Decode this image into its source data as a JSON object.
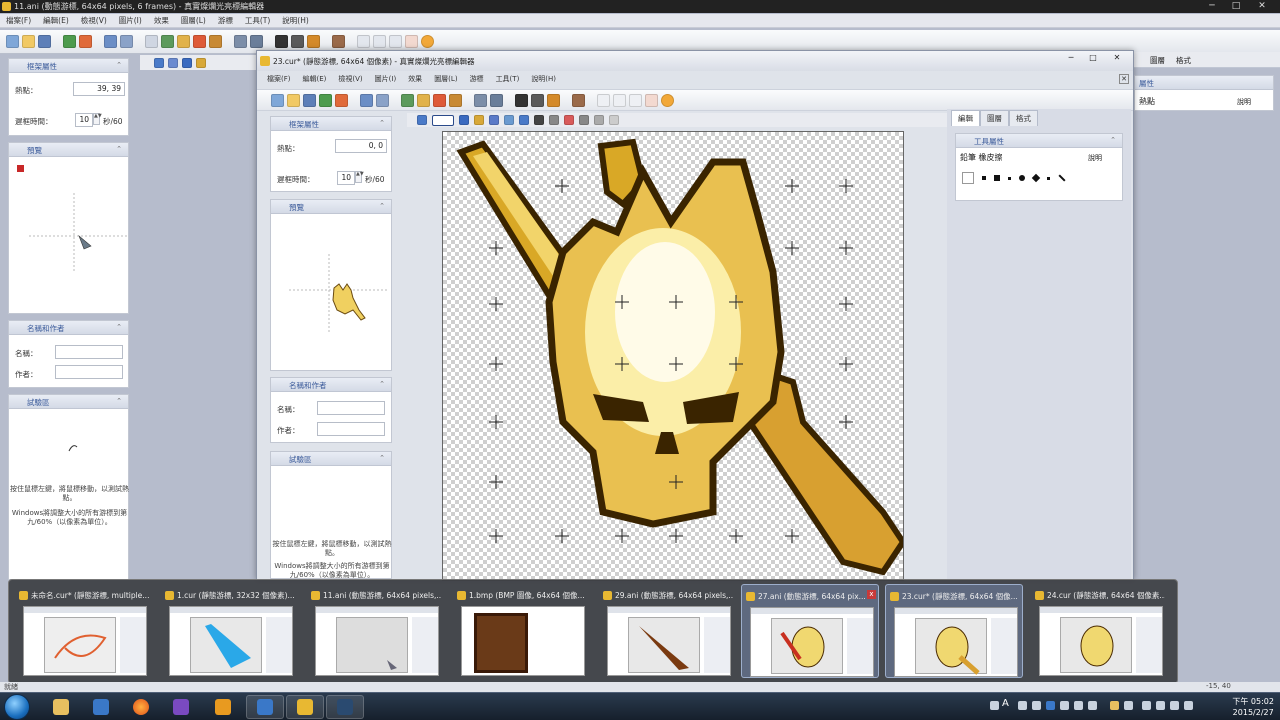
{
  "outer_window": {
    "title": "11.ani (動態游標, 64x64 pixels, 6 frames) - 真實燦爛光亮標編輯器",
    "menu": [
      "檔案(F)",
      "編輯(E)",
      "檢視(V)",
      "圖片(I)",
      "效果",
      "圖層(L)",
      "游標",
      "工具(T)",
      "說明(H)"
    ],
    "right_tabs": [
      "圖層",
      "格式"
    ],
    "right_panel_header": "屬性",
    "hotspot_panel_text": "熱點",
    "help_label": "說明",
    "frame_props": {
      "header": "框架屬性",
      "hotspot_label": "熱點：",
      "hotspot_value": "39, 39",
      "delay_label": "遲框時間：",
      "delay_value": "10",
      "delay_unit": "秒/60"
    },
    "preview": {
      "header": "預覽"
    },
    "name_author": {
      "header": "名稱和作者",
      "name_label": "名稱：",
      "author_label": "作者："
    },
    "test_area": {
      "header": "試驗區",
      "text1": "按住鼠標左鍵，將鼠標移動，以測試熱點。",
      "text2": "Windows將調整大小的所有游標到第九/60%（以像素為單位）。"
    }
  },
  "inner_window": {
    "title": "23.cur* (靜態游標, 64x64 個像素) - 真實燦爛光亮標編輯器",
    "menu": [
      "檔案(F)",
      "編輯(E)",
      "檢視(V)",
      "圖片(I)",
      "效果",
      "圖層(L)",
      "游標",
      "工具(T)",
      "說明(H)"
    ],
    "frame_props": {
      "header": "框架屬性",
      "hotspot_label": "熱點：",
      "hotspot_value": "0, 0",
      "delay_label": "遲框時間：",
      "delay_value": "10",
      "delay_unit": "秒/60"
    },
    "preview": {
      "header": "預覽"
    },
    "name_author": {
      "header": "名稱和作者",
      "name_label": "名稱：",
      "author_label": "作者："
    },
    "test_area": {
      "header": "試驗區",
      "text1": "按住鼠標左鍵，將鼠標移動，以測試熱點。",
      "text2": "Windows將調整大小的所有游標到第九/60%（以像素為單位）。"
    },
    "right_tabs": [
      "編輯",
      "圖層",
      "格式"
    ],
    "tool_props": {
      "header": "工具屬性",
      "tool_name": "鉛筆 橡皮擦",
      "help_label": "說明"
    }
  },
  "thumbnails": [
    {
      "title": "未命名.cur* (靜態游標, multiple...",
      "hot": false
    },
    {
      "title": "1.cur (靜態游標, 32x32 個像素)...",
      "hot": false
    },
    {
      "title": "11.ani (動態游標, 64x64 pixels,...",
      "hot": false
    },
    {
      "title": "1.bmp (BMP 圖像, 64x64 個像...",
      "hot": false
    },
    {
      "title": "29.ani (動態游標, 64x64 pixels,...",
      "hot": false
    },
    {
      "title": "27.ani (動態游標, 64x64 pix...",
      "hot": true,
      "close": "x"
    },
    {
      "title": "23.cur* (靜態游標, 64x64 個像...",
      "hot": true
    },
    {
      "title": "24.cur (靜態游標, 64x64 個像素...",
      "hot": false
    }
  ],
  "status": {
    "left": "就緒",
    "coords": "-15, 40"
  },
  "clock": {
    "time": "下午 05:02",
    "date": "2015/2/27"
  },
  "taskbar_icons": [
    "explorer-icon",
    "app-blue-icon",
    "firefox-icon",
    "visual-studio-icon",
    "media-player-icon",
    "app-blue-2-icon",
    "cursor-editor-icon",
    "terminal-icon"
  ],
  "colors": {
    "accent": "#3a5a9a",
    "gold": "#e8b832",
    "taskbar": "#1c2836"
  }
}
